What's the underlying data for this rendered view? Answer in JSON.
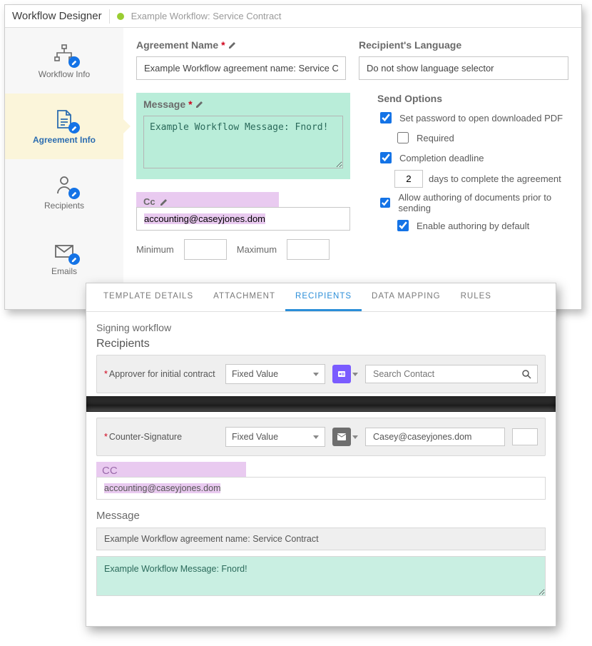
{
  "header": {
    "title": "Workflow Designer",
    "workflow_name": "Example Workflow: Service Contract"
  },
  "sidebar": {
    "items": [
      {
        "label": "Workflow Info"
      },
      {
        "label": "Agreement Info"
      },
      {
        "label": "Recipients"
      },
      {
        "label": "Emails"
      }
    ]
  },
  "agreement": {
    "name_label": "Agreement Name",
    "name_value": "Example Workflow agreement name: Service Contract",
    "lang_label": "Recipient's Language",
    "lang_value": "Do not show language selector",
    "msg_label": "Message",
    "msg_value": "Example Workflow Message: Fnord!",
    "cc_label": "Cc",
    "cc_value": "accounting@caseyjones.dom",
    "min_label": "Minimum",
    "max_label": "Maximum"
  },
  "send_options": {
    "title": "Send Options",
    "pdf_pw": "Set password to open downloaded PDF",
    "required": "Required",
    "deadline": "Completion deadline",
    "days_value": "2",
    "days_suffix": "days to complete the agreement",
    "authoring": "Allow authoring of documents prior to sending",
    "authoring_default": "Enable authoring by default"
  },
  "panel2": {
    "tabs": [
      {
        "label": "TEMPLATE DETAILS"
      },
      {
        "label": "ATTACHMENT"
      },
      {
        "label": "RECIPIENTS"
      },
      {
        "label": "DATA MAPPING"
      },
      {
        "label": "RULES"
      }
    ],
    "signing_title": "Signing workflow",
    "recipients_title": "Recipients",
    "rows": [
      {
        "label": "Approver for initial contract",
        "type": "Fixed Value",
        "contact_placeholder": "Search Contact",
        "contact_value": ""
      },
      {
        "label": "Counter-Signature",
        "type": "Fixed Value",
        "contact_placeholder": "",
        "contact_value": "Casey@caseyjones.dom"
      }
    ],
    "cc_label": "CC",
    "cc_value": "accounting@caseyjones.dom",
    "msg_label": "Message",
    "msg_name": "Example Workflow agreement name: Service Contract",
    "msg_body": "Example Workflow Message: Fnord!"
  }
}
